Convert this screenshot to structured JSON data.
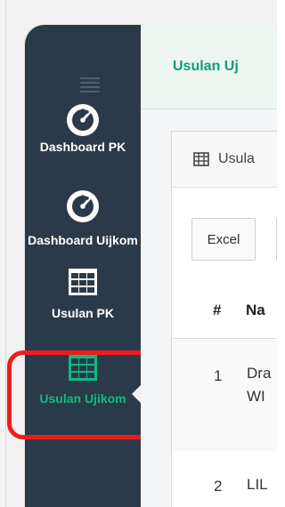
{
  "sidebar": {
    "items": [
      {
        "id": "dashboard-pk",
        "label": "Dashboard PK"
      },
      {
        "id": "dashboard-uijkom",
        "label": "Dashboard Uijkom"
      },
      {
        "id": "usulan-pk",
        "label": "Usulan PK"
      },
      {
        "id": "usulan-ujikom",
        "label": "Usulan Ujikom",
        "active": true
      }
    ]
  },
  "header": {
    "title": "Usulan Uj"
  },
  "panel": {
    "title": "Usula"
  },
  "toolbar": {
    "excel_label": "Excel"
  },
  "table": {
    "columns": [
      "#",
      "Na"
    ],
    "rows": [
      {
        "num": "1",
        "name": "Dra\nWI"
      },
      {
        "num": "2",
        "name": "LIL"
      }
    ]
  },
  "colors": {
    "sidebar_bg": "#2b3a4a",
    "active_green": "#11b981",
    "title_green": "#129c78",
    "highlight_red": "#ef1c1c"
  }
}
